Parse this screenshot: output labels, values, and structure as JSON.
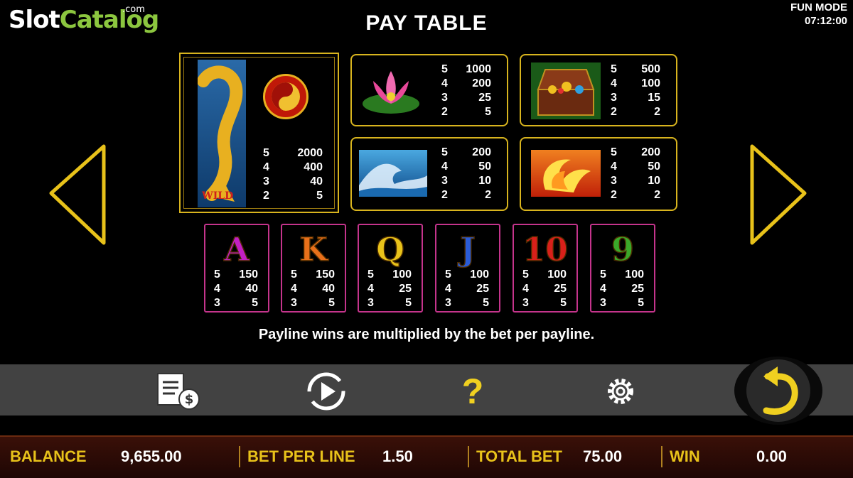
{
  "logo": {
    "slot": "Slot",
    "catalog": "Catalog",
    "com": ".com"
  },
  "status": {
    "mode": "FUN MODE",
    "time": "07:12:00"
  },
  "title": "PAY TABLE",
  "wild": {
    "label": "WILD",
    "pays": [
      [
        "5",
        "2000"
      ],
      [
        "4",
        "400"
      ],
      [
        "3",
        "40"
      ],
      [
        "2",
        "5"
      ]
    ]
  },
  "high_symbols": [
    {
      "name": "lotus",
      "pays": [
        [
          "5",
          "1000"
        ],
        [
          "4",
          "200"
        ],
        [
          "3",
          "25"
        ],
        [
          "2",
          "5"
        ]
      ]
    },
    {
      "name": "treasure-chest",
      "pays": [
        [
          "5",
          "500"
        ],
        [
          "4",
          "100"
        ],
        [
          "3",
          "15"
        ],
        [
          "2",
          "2"
        ]
      ]
    },
    {
      "name": "wave",
      "pays": [
        [
          "5",
          "200"
        ],
        [
          "4",
          "50"
        ],
        [
          "3",
          "10"
        ],
        [
          "2",
          "2"
        ]
      ]
    },
    {
      "name": "phoenix",
      "pays": [
        [
          "5",
          "200"
        ],
        [
          "4",
          "50"
        ],
        [
          "3",
          "10"
        ],
        [
          "2",
          "2"
        ]
      ]
    }
  ],
  "low_symbols": [
    {
      "label": "A",
      "color": "#c21fc4",
      "pays": [
        [
          "5",
          "150"
        ],
        [
          "4",
          "40"
        ],
        [
          "3",
          "5"
        ]
      ]
    },
    {
      "label": "K",
      "color": "#e8701a",
      "pays": [
        [
          "5",
          "150"
        ],
        [
          "4",
          "40"
        ],
        [
          "3",
          "5"
        ]
      ]
    },
    {
      "label": "Q",
      "color": "#e8c21a",
      "pays": [
        [
          "5",
          "100"
        ],
        [
          "4",
          "25"
        ],
        [
          "3",
          "5"
        ]
      ]
    },
    {
      "label": "J",
      "color": "#2a5cd8",
      "pays": [
        [
          "5",
          "100"
        ],
        [
          "4",
          "25"
        ],
        [
          "3",
          "5"
        ]
      ]
    },
    {
      "label": "10",
      "color": "#d8201a",
      "pays": [
        [
          "5",
          "100"
        ],
        [
          "4",
          "25"
        ],
        [
          "3",
          "5"
        ]
      ]
    },
    {
      "label": "9",
      "color": "#3aa82a",
      "pays": [
        [
          "5",
          "100"
        ],
        [
          "4",
          "25"
        ],
        [
          "3",
          "5"
        ]
      ]
    }
  ],
  "note": "Payline wins are multiplied by the bet per payline.",
  "toolbar": {
    "icons": [
      "paytable-icon",
      "autoplay-icon",
      "help-icon",
      "settings-icon",
      "back-icon"
    ],
    "help": "?"
  },
  "bottom": {
    "balance_label": "BALANCE",
    "balance": "9,655.00",
    "bet_label": "BET PER LINE",
    "bet": "1.50",
    "total_label": "TOTAL BET",
    "total": "75.00",
    "win_label": "WIN",
    "win": "0.00"
  },
  "colors": {
    "gold": "#e8c21a",
    "pink_border": "#c5348c",
    "logo_green": "#8cc63f"
  }
}
